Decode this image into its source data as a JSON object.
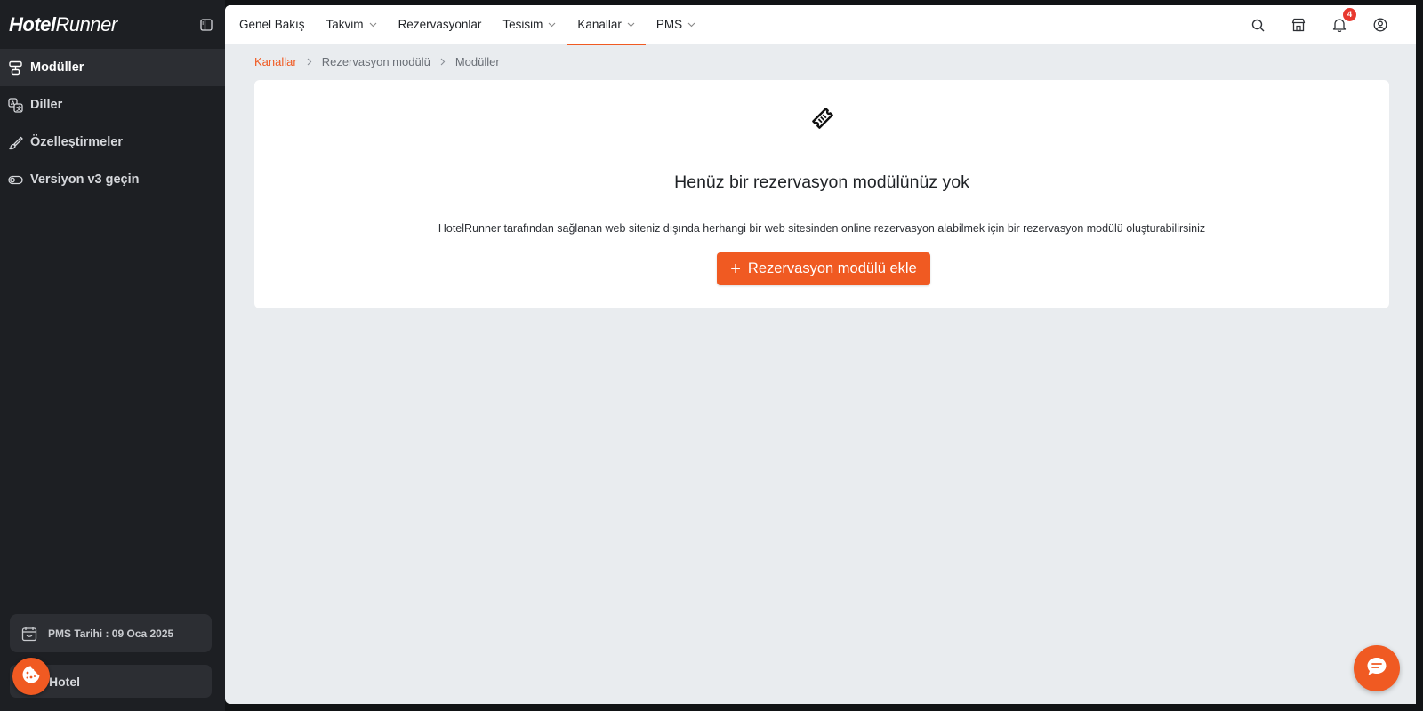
{
  "sidebar": {
    "logo_part1": "Hotel",
    "logo_part2": "Runner",
    "items": [
      {
        "label": "Modüller",
        "icon": "modules-icon",
        "active": true
      },
      {
        "label": "Diller",
        "icon": "languages-icon",
        "active": false
      },
      {
        "label": "Özelleştirmeler",
        "icon": "brush-icon",
        "active": false
      },
      {
        "label": "Versiyon v3 geçin",
        "icon": "toggle-icon",
        "active": false
      }
    ],
    "pms_date": "PMS Tarihi : 09 Oca 2025",
    "hotel": "Hotel"
  },
  "topbar": {
    "tabs": [
      {
        "label": "Genel Bakış",
        "dropdown": false
      },
      {
        "label": "Takvim",
        "dropdown": true
      },
      {
        "label": "Rezervasyonlar",
        "dropdown": false
      },
      {
        "label": "Tesisim",
        "dropdown": true
      },
      {
        "label": "Kanallar",
        "dropdown": true,
        "active": true
      },
      {
        "label": "PMS",
        "dropdown": true
      }
    ],
    "notification_count": "4"
  },
  "breadcrumb": {
    "items": [
      "Kanallar",
      "Rezervasyon modülü",
      "Modüller"
    ]
  },
  "empty_state": {
    "title": "Henüz bir rezervasyon modülünüz yok",
    "description": "HotelRunner tarafından sağlanan web siteniz dışında herhangi bir web sitesinden online rezervasyon alabilmek için bir rezervasyon modülü oluşturabilirsiniz",
    "button_label": "Rezervasyon modülü ekle"
  },
  "colors": {
    "accent": "#f05a22",
    "sidebar_bg": "#1d1f23",
    "content_bg": "#e9ecef",
    "badge": "#e8392f"
  }
}
